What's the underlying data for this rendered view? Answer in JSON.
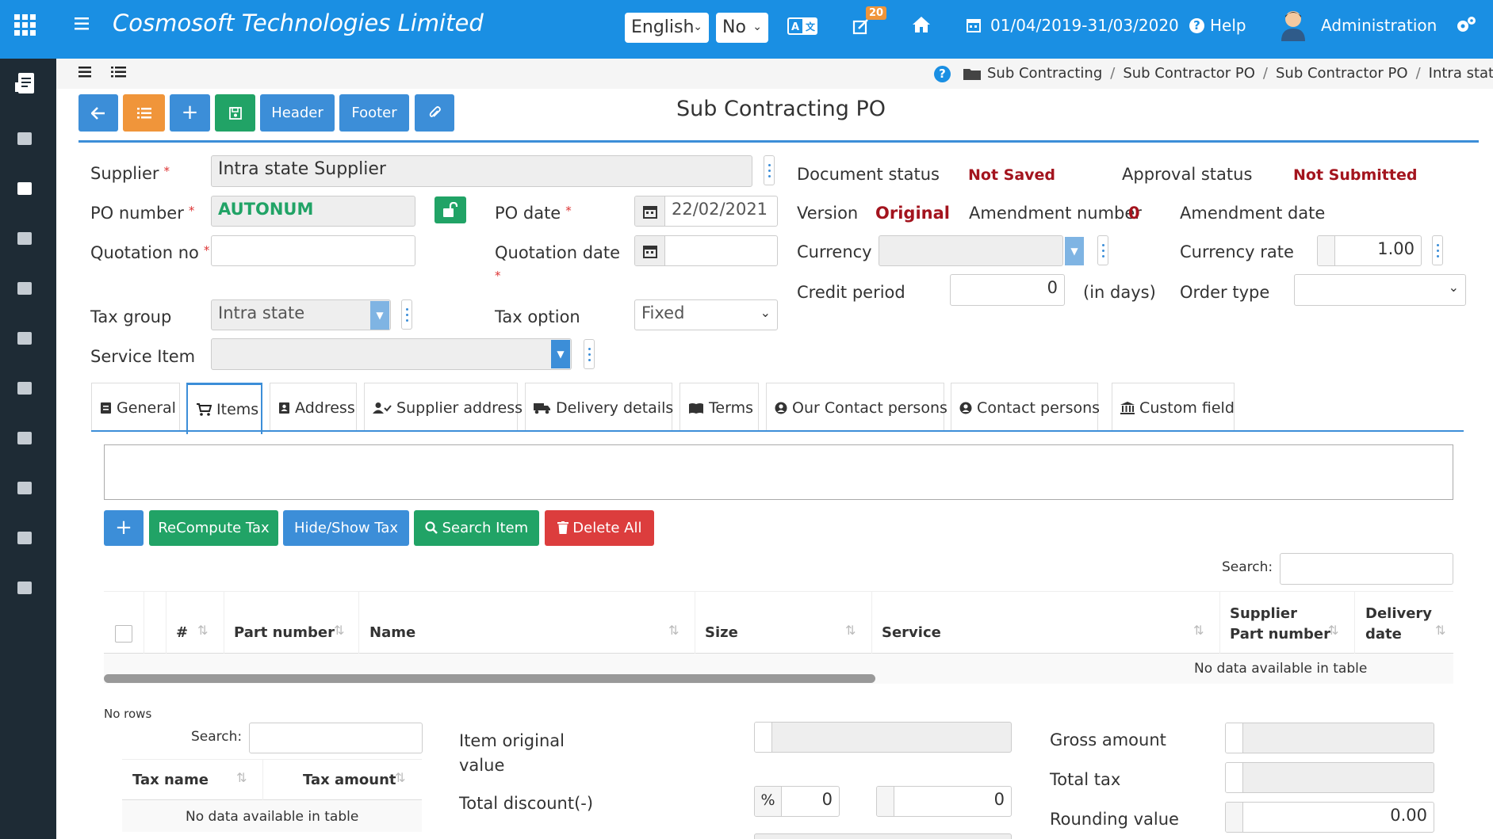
{
  "header": {
    "company": "Cosmosoft Technologies Limited",
    "language": "English",
    "toggle": "No",
    "notif_count": "20",
    "date_range": "01/04/2019-31/03/2020",
    "help": "Help",
    "user": "Administration"
  },
  "breadcrumb": [
    "Sub Contracting",
    "Sub Contractor PO",
    "Sub Contractor PO",
    "Intra state"
  ],
  "toolbar": {
    "header": "Header",
    "footer": "Footer"
  },
  "page_title": "Sub Contracting PO",
  "form": {
    "supplier_label": "Supplier",
    "supplier_value": "Intra state Supplier",
    "po_number_label": "PO number",
    "po_number_value": "AUTONUM",
    "po_date_label": "PO date",
    "po_date_value": "22/02/2021",
    "quotation_no_label": "Quotation no",
    "quotation_date_label": "Quotation date",
    "tax_group_label": "Tax group",
    "tax_group_value": "Intra state",
    "tax_option_label": "Tax option",
    "tax_option_value": "Fixed",
    "service_item_label": "Service Item",
    "required_mark": "*"
  },
  "status": {
    "document_status_label": "Document status",
    "document_status_value": "Not Saved",
    "approval_status_label": "Approval status",
    "approval_status_value": "Not Submitted",
    "version_label": "Version",
    "version_value": "Original",
    "amendment_number_label": "Amendment number",
    "amendment_number_value": "0",
    "amendment_date_label": "Amendment date",
    "currency_label": "Currency",
    "currency_rate_label": "Currency rate",
    "currency_rate_value": "1.00",
    "credit_period_label": "Credit period",
    "credit_period_value": "0",
    "credit_period_unit": "(in days)",
    "order_type_label": "Order type"
  },
  "tabs": [
    "General",
    "Items",
    "Address",
    "Supplier address",
    "Delivery details",
    "Terms",
    "Our Contact persons",
    "Contact persons",
    "Custom field"
  ],
  "items": {
    "buttons": {
      "recompute": "ReCompute Tax",
      "hideshow": "Hide/Show Tax",
      "search": "Search Item",
      "delete_all": "Delete All"
    },
    "search_label": "Search:",
    "columns": [
      "#",
      "Part number",
      "Name",
      "Size",
      "Service",
      "Supplier",
      "Part number",
      "Delivery",
      "date"
    ],
    "empty": "No data available in table"
  },
  "tax": {
    "no_rows": "No rows",
    "search_label": "Search:",
    "columns": [
      "Tax name",
      "Tax amount"
    ],
    "empty": "No data available in table"
  },
  "totals": {
    "item_original_value_label_1": "Item original",
    "item_original_value_label_2": "value",
    "total_discount_label": "Total discount(-)",
    "discount_pct_symbol": "%",
    "discount_pct_value": "0",
    "discount_amount_value": "0",
    "gross_amount_label": "Gross amount",
    "total_tax_label": "Total tax",
    "rounding_value_label": "Rounding value",
    "rounding_value": "0.00"
  },
  "colors": {
    "primary": "#1a8fe3",
    "sidebar": "#1e2b35",
    "status_red": "#a3141e",
    "green": "#21a366",
    "orange": "#f0953a",
    "red": "#dc3d3d"
  }
}
